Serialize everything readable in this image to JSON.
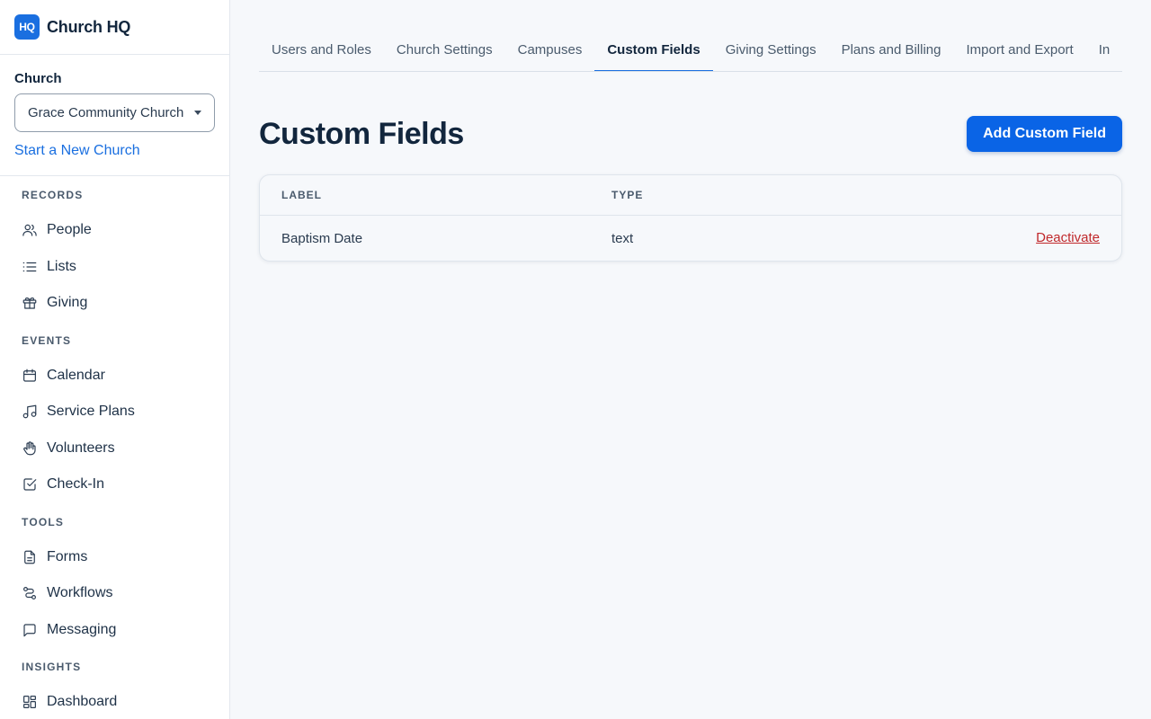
{
  "brand": {
    "logo_text": "HQ",
    "name": "Church HQ"
  },
  "church": {
    "label": "Church",
    "selected": "Grace Community Church",
    "new_church_link": "Start a New Church"
  },
  "nav": {
    "records_title": "RECORDS",
    "records": [
      {
        "label": "People",
        "icon": "people-icon"
      },
      {
        "label": "Lists",
        "icon": "list-icon"
      },
      {
        "label": "Giving",
        "icon": "gift-icon"
      }
    ],
    "events_title": "EVENTS",
    "events": [
      {
        "label": "Calendar",
        "icon": "calendar-icon"
      },
      {
        "label": "Service Plans",
        "icon": "music-icon"
      },
      {
        "label": "Volunteers",
        "icon": "hand-icon"
      },
      {
        "label": "Check-In",
        "icon": "checkbox-icon"
      }
    ],
    "tools_title": "TOOLS",
    "tools": [
      {
        "label": "Forms",
        "icon": "document-icon"
      },
      {
        "label": "Workflows",
        "icon": "route-icon"
      },
      {
        "label": "Messaging",
        "icon": "chat-icon"
      }
    ],
    "insights_title": "INSIGHTS",
    "insights": [
      {
        "label": "Dashboard",
        "icon": "dashboard-icon"
      }
    ]
  },
  "tabs": [
    {
      "label": "Users and Roles"
    },
    {
      "label": "Church Settings"
    },
    {
      "label": "Campuses"
    },
    {
      "label": "Custom Fields",
      "active": true
    },
    {
      "label": "Giving Settings"
    },
    {
      "label": "Plans and Billing"
    },
    {
      "label": "Import and Export"
    },
    {
      "label": "In"
    }
  ],
  "page": {
    "title": "Custom Fields",
    "add_button": "Add Custom Field"
  },
  "table": {
    "headers": {
      "label": "LABEL",
      "type": "TYPE"
    },
    "rows": [
      {
        "label": "Baptism Date",
        "type": "text",
        "action": "Deactivate"
      }
    ]
  },
  "colors": {
    "accent": "#0a64e6",
    "danger": "#c0282b"
  }
}
